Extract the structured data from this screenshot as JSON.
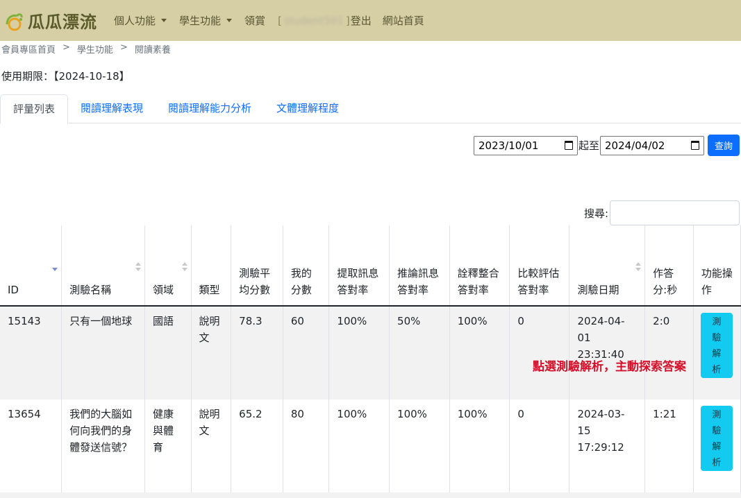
{
  "brand": {
    "name": "瓜瓜漂流"
  },
  "nav": {
    "items": [
      {
        "label": "個人功能",
        "dropdown": true
      },
      {
        "label": "學生功能",
        "dropdown": true
      },
      {
        "label": "領賞",
        "dropdown": false
      }
    ],
    "user_open": "[",
    "user_name": "student501",
    "user_close": "]",
    "logout": "登出",
    "home": "網站首頁"
  },
  "breadcrumb": [
    "會員專區首頁",
    "學生功能",
    "閱讀素養"
  ],
  "breadcrumb_sep": ">",
  "expiry_text": "使用期限：【2024-10-18】",
  "tabs": [
    {
      "label": "評量列表",
      "active": true
    },
    {
      "label": "閱讀理解表現",
      "active": false
    },
    {
      "label": "閱讀理解能力分析",
      "active": false
    },
    {
      "label": "文體理解程度",
      "active": false
    }
  ],
  "filter": {
    "start_date": "2023/10/01",
    "between": "起至",
    "end_date": "2024/04/02",
    "query_label": "查詢"
  },
  "search": {
    "label": "搜尋:"
  },
  "table": {
    "headers": [
      {
        "label": "ID",
        "sortable": true,
        "sorted": "desc"
      },
      {
        "label": "測驗名稱",
        "sortable": true
      },
      {
        "label": "領域",
        "sortable": true
      },
      {
        "label": "類型"
      },
      {
        "label": "測驗平均分數"
      },
      {
        "label": "我的分數"
      },
      {
        "label": "提取訊息答對率"
      },
      {
        "label": "推論訊息答對率"
      },
      {
        "label": "詮釋整合答對率"
      },
      {
        "label": "比較評估答對率"
      },
      {
        "label": "測驗日期",
        "sortable": true
      },
      {
        "label": "作答分:秒"
      },
      {
        "label": "功能操作"
      }
    ],
    "rows": [
      {
        "id": "15143",
        "name": "只有一個地球",
        "domain": "國語",
        "type": "說明文",
        "avg": "78.3",
        "score": "60",
        "retrieve": "100%",
        "infer": "50%",
        "interpret": "100%",
        "evaluate": "0",
        "date": "2024-04-01 23:31:40",
        "time": "2:0",
        "action": "測驗解析"
      },
      {
        "id": "13654",
        "name": "我們的大腦如何向我們的身體發送信號？",
        "domain": "健康與體育",
        "type": "說明文",
        "avg": "65.2",
        "score": "80",
        "retrieve": "100%",
        "infer": "100%",
        "interpret": "100%",
        "evaluate": "0",
        "date": "2024-03-15 17:29:12",
        "time": "1:21",
        "action": "測驗解析"
      }
    ]
  },
  "annotation": "點選測驗解析，主動探索答案",
  "colors": {
    "navbar": "#d6cfa6",
    "primary": "#0d6efd",
    "info": "#13caf0",
    "annotation": "#d4112a"
  }
}
